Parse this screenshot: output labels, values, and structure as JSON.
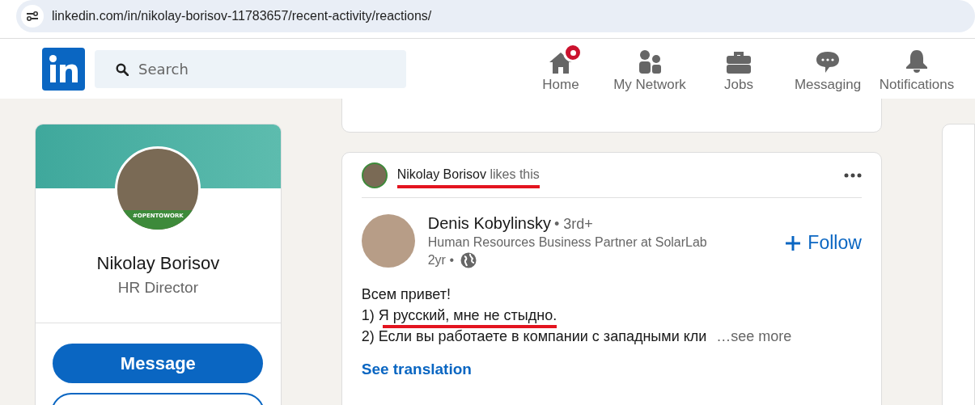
{
  "browser": {
    "url": "linkedin.com/in/nikolay-borisov-11783657/recent-activity/reactions/"
  },
  "nav": {
    "search": {
      "placeholder": "Search"
    },
    "items": [
      {
        "label": "Home",
        "kind": "home",
        "badge": true
      },
      {
        "label": "My Network",
        "kind": "network",
        "badge": false
      },
      {
        "label": "Jobs",
        "kind": "jobs",
        "badge": false
      },
      {
        "label": "Messaging",
        "kind": "messaging",
        "badge": false
      },
      {
        "label": "Notifications",
        "kind": "notifications",
        "badge": false
      }
    ]
  },
  "profile": {
    "name": "Nikolay Borisov",
    "headline": "HR Director",
    "open_to_work": "#OPENTOWORK",
    "message_button": "Message"
  },
  "post": {
    "activity": {
      "actor": "Nikolay Borisov",
      "action": "likes this",
      "underlined": true
    },
    "author": {
      "name": "Denis Kobylinsky",
      "degree": "• 3rd+",
      "headline": "Human Resources Business Partner at SolarLab",
      "time": "2yr •",
      "follow": "Follow"
    },
    "lines": [
      {
        "text": "Всем привет!",
        "underlined": false
      },
      {
        "text": "1) Я русский, мне не стыдно.",
        "underlined": true
      },
      {
        "text": "2) Если вы работаете в компании с западными кли",
        "underlined": false
      }
    ],
    "see_more": "…see more",
    "see_translation": "See translation"
  }
}
